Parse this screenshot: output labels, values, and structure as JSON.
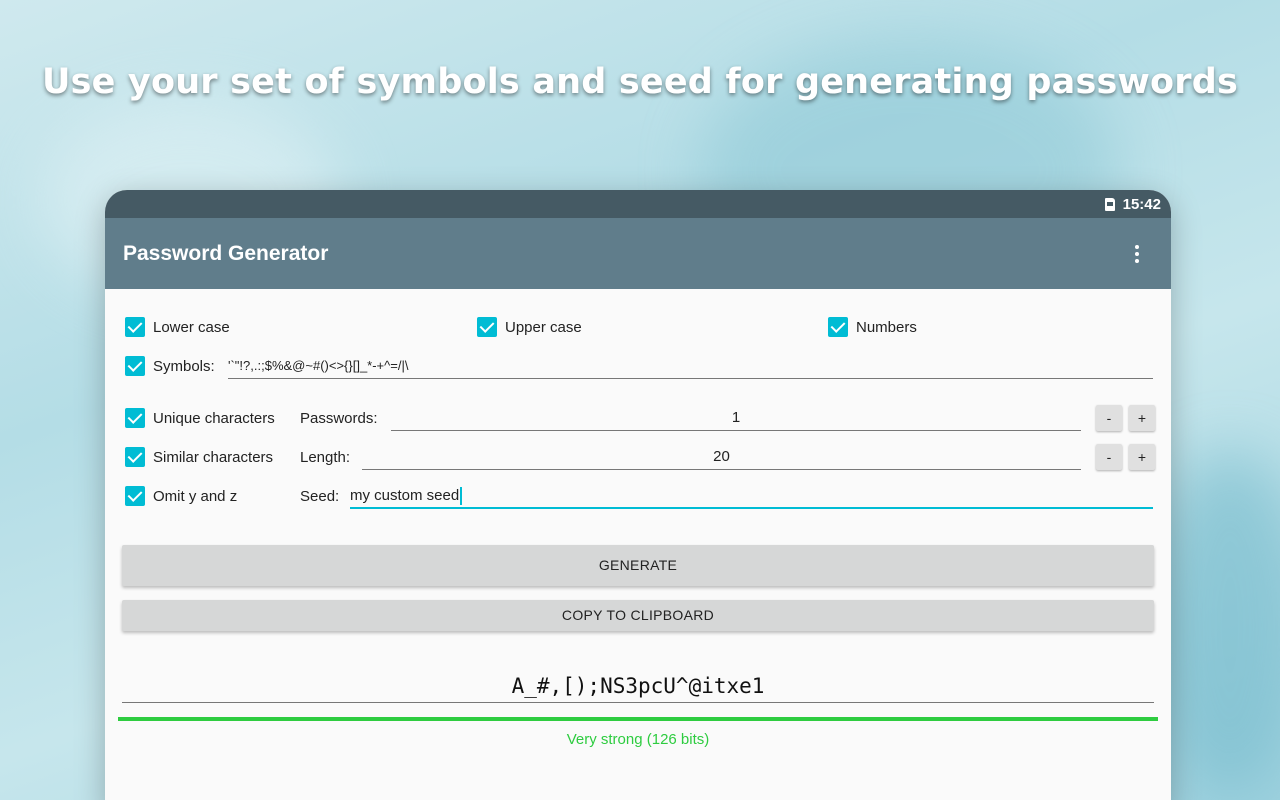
{
  "headline": "Use your set of symbols and seed for generating passwords",
  "status_bar": {
    "time": "15:42"
  },
  "app_bar": {
    "title": "Password Generator",
    "menu_icon": "more-vert-icon"
  },
  "options": {
    "lower_case": {
      "label": "Lower case",
      "checked": true
    },
    "upper_case": {
      "label": "Upper case",
      "checked": true
    },
    "numbers": {
      "label": "Numbers",
      "checked": true
    },
    "symbols": {
      "label": "Symbols:",
      "checked": true,
      "value": "'`\"!?,.:;$%&@~#()<>{}[]_*-+^=/|\\"
    },
    "unique_characters": {
      "label": "Unique characters",
      "checked": true
    },
    "similar_characters": {
      "label": "Similar characters",
      "checked": true
    },
    "omit_y_and_z": {
      "label": "Omit y and z",
      "checked": true
    }
  },
  "passwords": {
    "label": "Passwords:",
    "value": "1",
    "minus": "-",
    "plus": "+"
  },
  "length": {
    "label": "Length:",
    "value": "20",
    "minus": "-",
    "plus": "+"
  },
  "seed": {
    "label": "Seed:",
    "value": "my custom seed"
  },
  "buttons": {
    "generate": "GENERATE",
    "copy": "COPY TO CLIPBOARD"
  },
  "result": {
    "password": "A_#,[);NS3pcU^@itxe1",
    "strength_text": "Very strong (126 bits)",
    "strength_color": "#2ecc40",
    "strength_level": 1.0
  },
  "colors": {
    "accent": "#00bcd4",
    "app_bar": "#607d8b",
    "status_bar": "#455a64"
  }
}
